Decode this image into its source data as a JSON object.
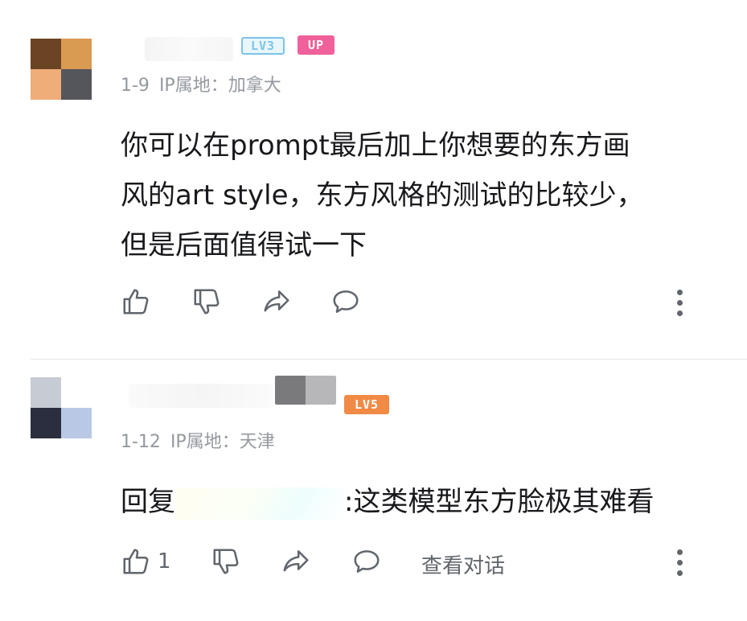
{
  "comments": [
    {
      "user_level": "LV3",
      "up_badge": "UP",
      "date": "1-9",
      "ip_label": "IP属地：加拿大",
      "text_lines": [
        "你可以在prompt最后加上你想要的东方画",
        "风的art style，东方风格的测试的比较少，",
        "但是后面值得试一下"
      ],
      "like_count": "",
      "avatar_colors": [
        "#6b4423",
        "#d99a52",
        "#efad7a",
        "#55565b"
      ]
    },
    {
      "user_level": "LV5",
      "date": "1-12",
      "ip_label": "IP属地：天津",
      "reply_prefix": "回复",
      "reply_text": ":这类模型东方脸极其难看",
      "like_count": "1",
      "view_conversation": "查看对话",
      "avatar_colors": [
        "#c7cbd3",
        "#ffffff",
        "#2a2e3f",
        "#b9c8e4"
      ]
    }
  ],
  "colors": {
    "lv3": "#7cc3ea",
    "up": "#f0609a",
    "lv5": "#f08a45",
    "meta": "#9499a0",
    "icon": "#61666d"
  },
  "icons": [
    "thumbs-up-icon",
    "thumbs-down-icon",
    "share-icon",
    "reply-icon",
    "more-vertical-icon"
  ]
}
